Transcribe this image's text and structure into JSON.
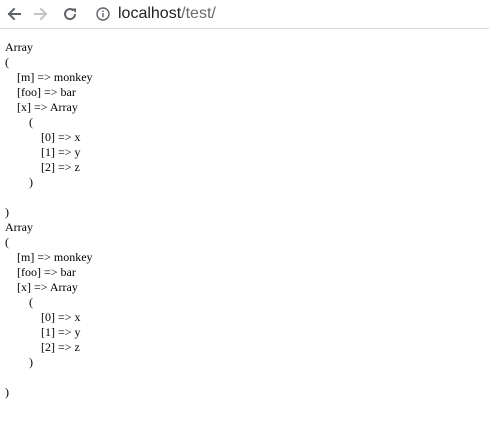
{
  "browser": {
    "url_host": "localhost",
    "url_path": "/test/",
    "icons": {
      "back": "arrow-left-icon",
      "forward": "arrow-right-icon",
      "reload": "reload-icon",
      "info": "info-icon"
    }
  },
  "page": {
    "output": "Array\n(\n    [m] => monkey\n    [foo] => bar\n    [x] => Array\n        (\n            [0] => x\n            [1] => y\n            [2] => z\n        )\n\n)\nArray\n(\n    [m] => monkey\n    [foo] => bar\n    [x] => Array\n        (\n            [0] => x\n            [1] => y\n            [2] => z\n        )\n\n)"
  }
}
